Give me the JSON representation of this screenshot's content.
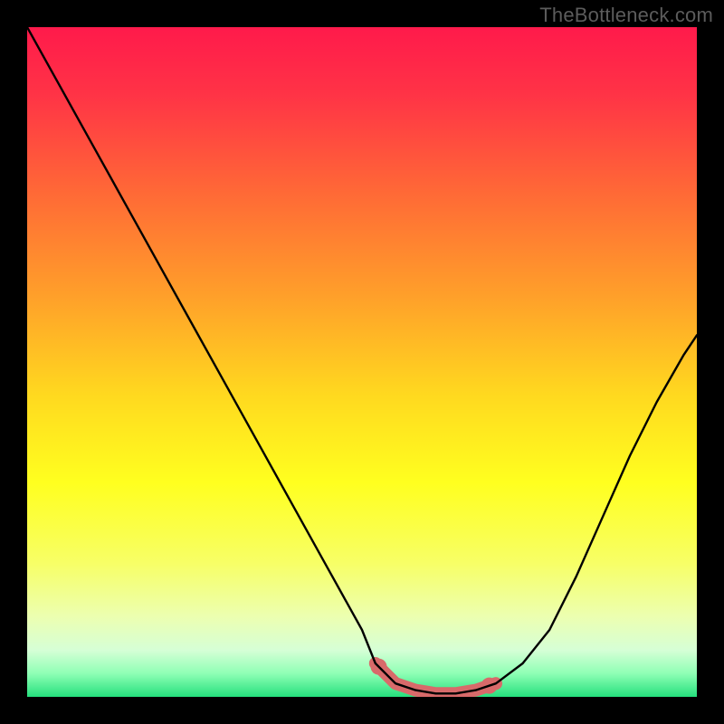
{
  "watermark": "TheBottleneck.com",
  "gradient_stops": [
    {
      "offset": 0.0,
      "color": "#ff1a4b"
    },
    {
      "offset": 0.1,
      "color": "#ff3346"
    },
    {
      "offset": 0.25,
      "color": "#ff6a36"
    },
    {
      "offset": 0.4,
      "color": "#ff9f2a"
    },
    {
      "offset": 0.55,
      "color": "#ffd91f"
    },
    {
      "offset": 0.68,
      "color": "#ffff1f"
    },
    {
      "offset": 0.8,
      "color": "#f7ff66"
    },
    {
      "offset": 0.88,
      "color": "#ecffb0"
    },
    {
      "offset": 0.93,
      "color": "#d6ffd6"
    },
    {
      "offset": 0.965,
      "color": "#8fffb5"
    },
    {
      "offset": 1.0,
      "color": "#25e07d"
    }
  ],
  "curve_color": "#000000",
  "curve_stroke_width": 2.4,
  "highlight": {
    "color": "#d86a6a",
    "stroke_width": 14,
    "dot_radius": 9
  },
  "chart_data": {
    "type": "line",
    "title": "",
    "xlabel": "",
    "ylabel": "",
    "xlim": [
      0,
      100
    ],
    "ylim": [
      0,
      100
    ],
    "series": [
      {
        "name": "bottleneck-curve",
        "x": [
          0,
          5,
          10,
          15,
          20,
          25,
          30,
          35,
          40,
          45,
          50,
          52,
          55,
          58,
          61,
          64,
          67,
          70,
          74,
          78,
          82,
          86,
          90,
          94,
          98,
          100
        ],
        "y": [
          100,
          91,
          82,
          73,
          64,
          55,
          46,
          37,
          28,
          19,
          10,
          5,
          2,
          1,
          0.5,
          0.5,
          1,
          2,
          5,
          10,
          18,
          27,
          36,
          44,
          51,
          54
        ]
      }
    ],
    "highlight_segment": {
      "series": "bottleneck-curve",
      "x_start": 52,
      "x_end": 70,
      "dots_x": [
        52.5,
        69
      ]
    },
    "notes": "y represents bottleneck percentage; minimum (optimal) region near x≈62; background gradient maps y from 100 (red, top) to 0 (green, bottom)."
  }
}
